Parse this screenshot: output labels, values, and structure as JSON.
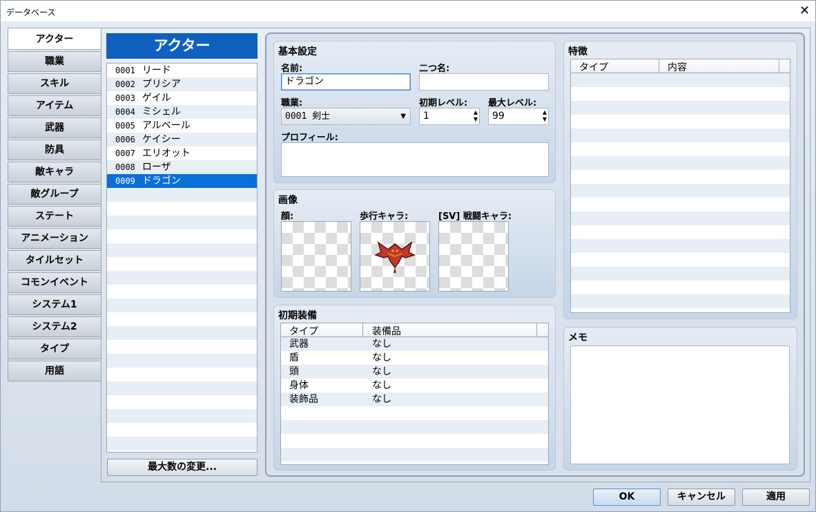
{
  "window": {
    "title": "データベース"
  },
  "tabs": [
    "アクター",
    "職業",
    "スキル",
    "アイテム",
    "武器",
    "防具",
    "敵キャラ",
    "敵グループ",
    "ステート",
    "アニメーション",
    "タイルセット",
    "コモンイベント",
    "システム1",
    "システム2",
    "タイプ",
    "用語"
  ],
  "actor_list": {
    "header": "アクター",
    "items": [
      {
        "id": "0001",
        "name": "リード"
      },
      {
        "id": "0002",
        "name": "プリシア"
      },
      {
        "id": "0003",
        "name": "ゲイル"
      },
      {
        "id": "0004",
        "name": "ミシェル"
      },
      {
        "id": "0005",
        "name": "アルベール"
      },
      {
        "id": "0006",
        "name": "ケイシー"
      },
      {
        "id": "0007",
        "name": "エリオット"
      },
      {
        "id": "0008",
        "name": "ローザ"
      },
      {
        "id": "0009",
        "name": "ドラゴン"
      }
    ],
    "selected": "0009",
    "change_max_button": "最大数の変更..."
  },
  "basic": {
    "heading": "基本設定",
    "name_label": "名前:",
    "name_value": "ドラゴン",
    "nickname_label": "二つ名:",
    "nickname_value": "",
    "class_label": "職業:",
    "class_value": "0001 剣士",
    "initial_level_label": "初期レベル:",
    "initial_level_value": "1",
    "max_level_label": "最大レベル:",
    "max_level_value": "99",
    "profile_label": "プロフィール:",
    "profile_value": ""
  },
  "images": {
    "heading": "画像",
    "face_label": "顔:",
    "character_label": "歩行キャラ:",
    "battler_label": "[SV] 戦闘キャラ:"
  },
  "equipment": {
    "heading": "初期装備",
    "col_type": "タイプ",
    "col_equip": "装備品",
    "rows": [
      {
        "type": "武器",
        "item": "なし"
      },
      {
        "type": "盾",
        "item": "なし"
      },
      {
        "type": "頭",
        "item": "なし"
      },
      {
        "type": "身体",
        "item": "なし"
      },
      {
        "type": "装飾品",
        "item": "なし"
      }
    ]
  },
  "traits": {
    "heading": "特徴",
    "col_type": "タイプ",
    "col_content": "内容"
  },
  "memo": {
    "heading": "メモ",
    "value": ""
  },
  "footer": {
    "ok": "OK",
    "cancel": "キャンセル",
    "apply": "適用"
  }
}
